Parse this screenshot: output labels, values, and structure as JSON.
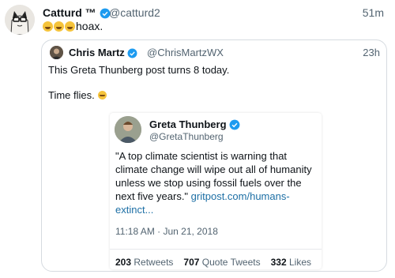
{
  "tweet": {
    "author_name": "Catturd ™",
    "author_handle": "@catturd2",
    "time": "51m",
    "text": "hoax.",
    "emoji_count": 3
  },
  "quoted": {
    "author_name": "Chris Martz",
    "author_handle": "@ChrisMartzWX",
    "time": "23h",
    "line1": "This Greta Thunberg post turns 8 today.",
    "line2": "Time flies."
  },
  "card": {
    "author_name": "Greta Thunberg",
    "author_handle": "@GretaThunberg",
    "body": "\"A top climate scientist is warning that climate change will wipe out all of humanity unless we stop using fossil fuels over the next five years.\"",
    "link": "gritpost.com/humans-extinct...",
    "date": "11:18 AM · Jun 21, 2018",
    "retweets_count": "203",
    "retweets_label": "Retweets",
    "quotes_count": "707",
    "quotes_label": "Quote Tweets",
    "likes_count": "332",
    "likes_label": "Likes"
  },
  "colors": {
    "verified": "#1d9bf0",
    "link": "#1d6fa5",
    "emoji": "#f5c33b"
  }
}
